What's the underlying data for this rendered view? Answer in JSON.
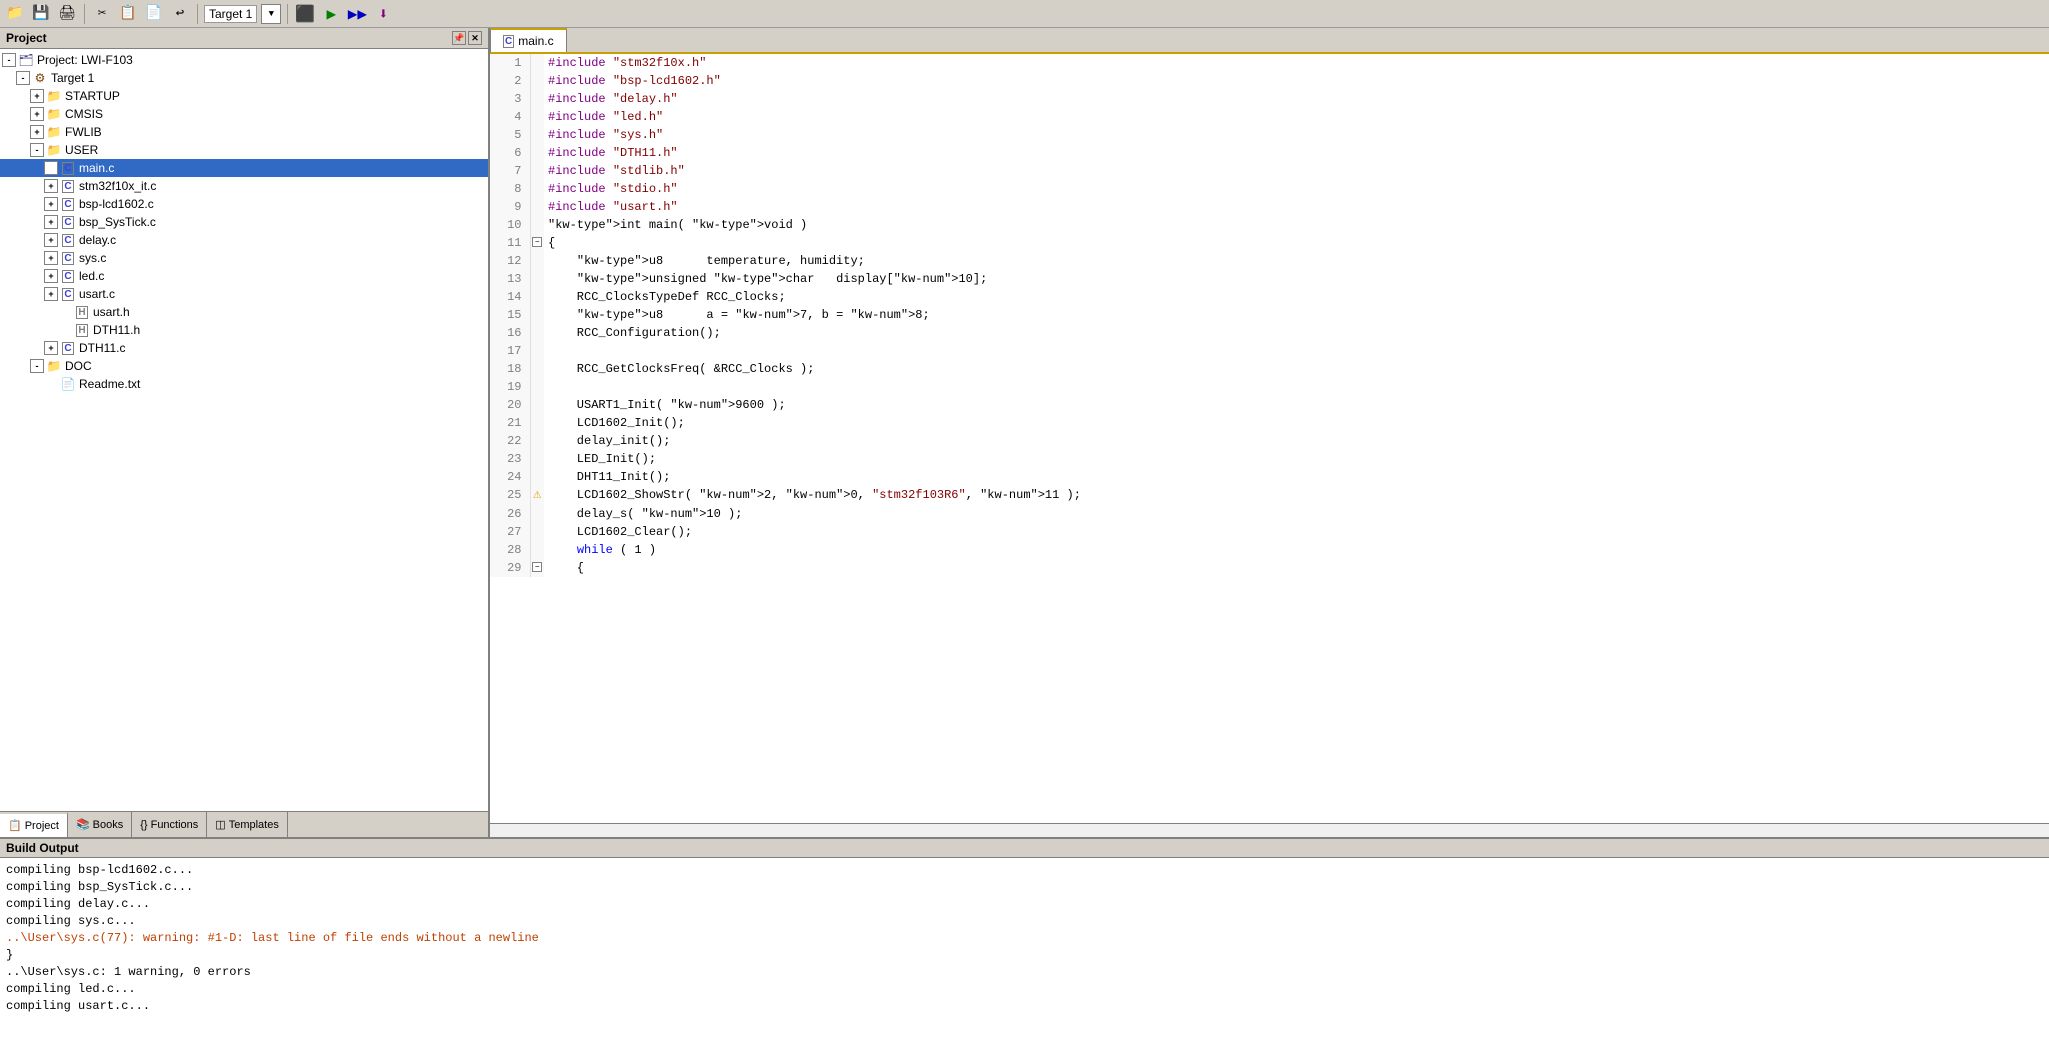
{
  "toolbar": {
    "target_label": "Target 1",
    "icons": [
      "📁",
      "💾",
      "🖨",
      "⚙",
      "📋",
      "▶",
      "⏸",
      "⏹",
      "🔨",
      "🔧"
    ]
  },
  "project_panel": {
    "title": "Project",
    "tree": [
      {
        "id": "project",
        "label": "Project: LWI-F103",
        "level": 0,
        "type": "project",
        "expanded": true,
        "expander": "-"
      },
      {
        "id": "target1",
        "label": "Target 1",
        "level": 1,
        "type": "target",
        "expanded": true,
        "expander": "-"
      },
      {
        "id": "startup",
        "label": "STARTUP",
        "level": 2,
        "type": "folder",
        "expanded": false,
        "expander": "+"
      },
      {
        "id": "cmsis",
        "label": "CMSIS",
        "level": 2,
        "type": "folder",
        "expanded": false,
        "expander": "+"
      },
      {
        "id": "fwlib",
        "label": "FWLIB",
        "level": 2,
        "type": "folder",
        "expanded": false,
        "expander": "+"
      },
      {
        "id": "user",
        "label": "USER",
        "level": 2,
        "type": "folder",
        "expanded": true,
        "expander": "-"
      },
      {
        "id": "mainc",
        "label": "main.c",
        "level": 3,
        "type": "file-c",
        "expanded": false,
        "expander": "+",
        "selected": true
      },
      {
        "id": "stm32",
        "label": "stm32f10x_it.c",
        "level": 3,
        "type": "file-c",
        "expanded": false,
        "expander": "+"
      },
      {
        "id": "bsp-lcd",
        "label": "bsp-lcd1602.c",
        "level": 3,
        "type": "file-c",
        "expanded": false,
        "expander": "+"
      },
      {
        "id": "bsp-sys",
        "label": "bsp_SysTick.c",
        "level": 3,
        "type": "file-c",
        "expanded": false,
        "expander": "+"
      },
      {
        "id": "delayc",
        "label": "delay.c",
        "level": 3,
        "type": "file-c",
        "expanded": false,
        "expander": "+"
      },
      {
        "id": "sysc",
        "label": "sys.c",
        "level": 3,
        "type": "file-c",
        "expanded": false,
        "expander": "+"
      },
      {
        "id": "ledc",
        "label": "led.c",
        "level": 3,
        "type": "file-c",
        "expanded": false,
        "expander": "+"
      },
      {
        "id": "usartc",
        "label": "usart.c",
        "level": 3,
        "type": "file-c",
        "expanded": false,
        "expander": "+"
      },
      {
        "id": "usarth",
        "label": "usart.h",
        "level": 4,
        "type": "file-h"
      },
      {
        "id": "dth11h",
        "label": "DTH11.h",
        "level": 4,
        "type": "file-h"
      },
      {
        "id": "dth11c",
        "label": "DTH11.c",
        "level": 3,
        "type": "file-c",
        "expanded": false,
        "expander": "+"
      },
      {
        "id": "doc",
        "label": "DOC",
        "level": 2,
        "type": "folder",
        "expanded": true,
        "expander": "-"
      },
      {
        "id": "readme",
        "label": "Readme.txt",
        "level": 3,
        "type": "file-txt"
      }
    ],
    "tabs": [
      {
        "id": "project",
        "label": "Project",
        "icon": "📋",
        "active": true
      },
      {
        "id": "books",
        "label": "Books",
        "icon": "📚",
        "active": false
      },
      {
        "id": "functions",
        "label": "Functions",
        "icon": "{}",
        "active": false
      },
      {
        "id": "templates",
        "label": "Templates",
        "icon": "◫",
        "active": false
      }
    ]
  },
  "editor": {
    "tabs": [
      {
        "label": "main.c",
        "active": true
      }
    ],
    "lines": [
      {
        "num": 1,
        "marker": "",
        "code": "#include \"stm32f10x.h\"",
        "type": "include"
      },
      {
        "num": 2,
        "marker": "",
        "code": "#include \"bsp-lcd1602.h\"",
        "type": "include"
      },
      {
        "num": 3,
        "marker": "",
        "code": "#include \"delay.h\"",
        "type": "include"
      },
      {
        "num": 4,
        "marker": "",
        "code": "#include \"led.h\"",
        "type": "include"
      },
      {
        "num": 5,
        "marker": "",
        "code": "#include \"sys.h\"",
        "type": "include"
      },
      {
        "num": 6,
        "marker": "",
        "code": "#include \"DTH11.h\"",
        "type": "include"
      },
      {
        "num": 7,
        "marker": "",
        "code": "#include \"stdlib.h\"",
        "type": "include"
      },
      {
        "num": 8,
        "marker": "",
        "code": "#include \"stdio.h\"",
        "type": "include"
      },
      {
        "num": 9,
        "marker": "",
        "code": "#include \"usart.h\"",
        "type": "include"
      },
      {
        "num": 10,
        "marker": "",
        "code": "int main( void )",
        "type": "normal"
      },
      {
        "num": 11,
        "marker": "fold",
        "code": "{",
        "type": "normal"
      },
      {
        "num": 12,
        "marker": "",
        "code": "    u8      temperature, humidity;",
        "type": "normal"
      },
      {
        "num": 13,
        "marker": "",
        "code": "    unsigned char   display[10];",
        "type": "normal"
      },
      {
        "num": 14,
        "marker": "",
        "code": "    RCC_ClocksTypeDef RCC_Clocks;",
        "type": "normal"
      },
      {
        "num": 15,
        "marker": "",
        "code": "    u8      a = 7, b = 8;",
        "type": "normal"
      },
      {
        "num": 16,
        "marker": "",
        "code": "    RCC_Configuration();",
        "type": "normal"
      },
      {
        "num": 17,
        "marker": "",
        "code": "",
        "type": "normal"
      },
      {
        "num": 18,
        "marker": "",
        "code": "    RCC_GetClocksFreq( &RCC_Clocks );",
        "type": "normal"
      },
      {
        "num": 19,
        "marker": "",
        "code": "",
        "type": "normal"
      },
      {
        "num": 20,
        "marker": "",
        "code": "    USART1_Init( 9600 );",
        "type": "normal"
      },
      {
        "num": 21,
        "marker": "",
        "code": "    LCD1602_Init();",
        "type": "normal"
      },
      {
        "num": 22,
        "marker": "",
        "code": "    delay_init();",
        "type": "normal"
      },
      {
        "num": 23,
        "marker": "",
        "code": "    LED_Init();",
        "type": "normal"
      },
      {
        "num": 24,
        "marker": "",
        "code": "    DHT11_Init();",
        "type": "normal"
      },
      {
        "num": 25,
        "marker": "warn",
        "code": "    LCD1602_ShowStr( 2, 0, \"stm32f103R6\", 11 );",
        "type": "normal"
      },
      {
        "num": 26,
        "marker": "",
        "code": "    delay_s( 10 );",
        "type": "normal"
      },
      {
        "num": 27,
        "marker": "",
        "code": "    LCD1602_Clear();",
        "type": "normal"
      },
      {
        "num": 28,
        "marker": "",
        "code": "    while ( 1 )",
        "type": "normal"
      },
      {
        "num": 29,
        "marker": "fold",
        "code": "    {",
        "type": "normal"
      }
    ]
  },
  "build_output": {
    "title": "Build Output",
    "lines": [
      {
        "text": "compiling bsp-lcd1602.c...",
        "type": "normal"
      },
      {
        "text": "compiling bsp_SysTick.c...",
        "type": "normal"
      },
      {
        "text": "compiling delay.c...",
        "type": "normal"
      },
      {
        "text": "compiling sys.c...",
        "type": "normal"
      },
      {
        "text": "..\\User\\sys.c(77): warning:  #1-D: last line of file ends without a newline",
        "type": "warning"
      },
      {
        "text": "    }",
        "type": "normal"
      },
      {
        "text": "..\\User\\sys.c: 1 warning, 0 errors",
        "type": "normal"
      },
      {
        "text": "compiling led.c...",
        "type": "normal"
      },
      {
        "text": "compiling usart.c...",
        "type": "normal"
      }
    ]
  }
}
